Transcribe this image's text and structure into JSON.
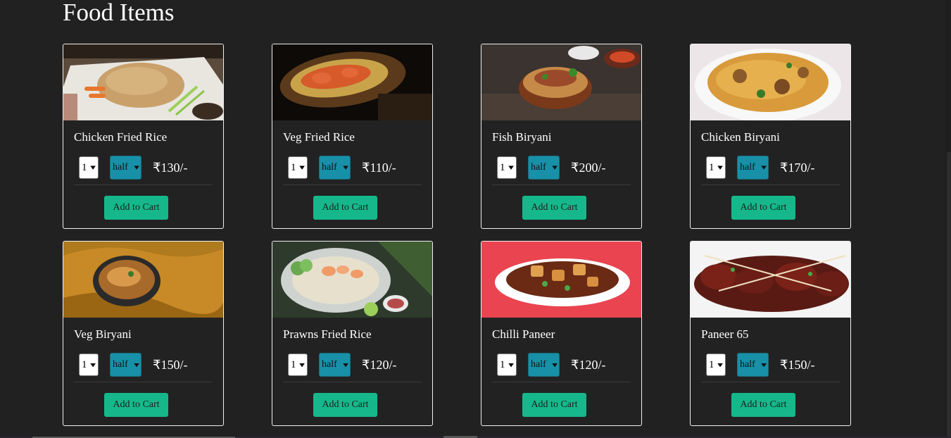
{
  "page": {
    "title": "Food Items"
  },
  "items": [
    {
      "name": "Chicken Fried Rice",
      "qty": "1",
      "size": "half",
      "price": "₹130/-",
      "cart_label": "Add to Cart",
      "image": "chicken-fried-rice-image"
    },
    {
      "name": "Veg Fried Rice",
      "qty": "1",
      "size": "half",
      "price": "₹110/-",
      "cart_label": "Add to Cart",
      "image": "veg-fried-rice-image"
    },
    {
      "name": "Fish Biryani",
      "qty": "1",
      "size": "half",
      "price": "₹200/-",
      "cart_label": "Add to Cart",
      "image": "fish-biryani-image"
    },
    {
      "name": "Chicken Biryani",
      "qty": "1",
      "size": "half",
      "price": "₹170/-",
      "cart_label": "Add to Cart",
      "image": "chicken-biryani-image"
    },
    {
      "name": "Veg Biryani",
      "qty": "1",
      "size": "half",
      "price": "₹150/-",
      "cart_label": "Add to Cart",
      "image": "veg-biryani-image"
    },
    {
      "name": "Prawns Fried Rice",
      "qty": "1",
      "size": "half",
      "price": "₹120/-",
      "cart_label": "Add to Cart",
      "image": "prawns-fried-rice-image"
    },
    {
      "name": "Chilli Paneer",
      "qty": "1",
      "size": "half",
      "price": "₹120/-",
      "cart_label": "Add to Cart",
      "image": "chilli-paneer-image"
    },
    {
      "name": "Paneer 65",
      "qty": "1",
      "size": "half",
      "price": "₹150/-",
      "cart_label": "Add to Cart",
      "image": "paneer-65-image"
    }
  ],
  "colors": {
    "background": "#212121",
    "card_border": "#f0f0f0",
    "size_select": "#1790a8",
    "cart_button": "#16b88b"
  },
  "icons": {
    "select_arrow": "chevron-down-icon"
  }
}
